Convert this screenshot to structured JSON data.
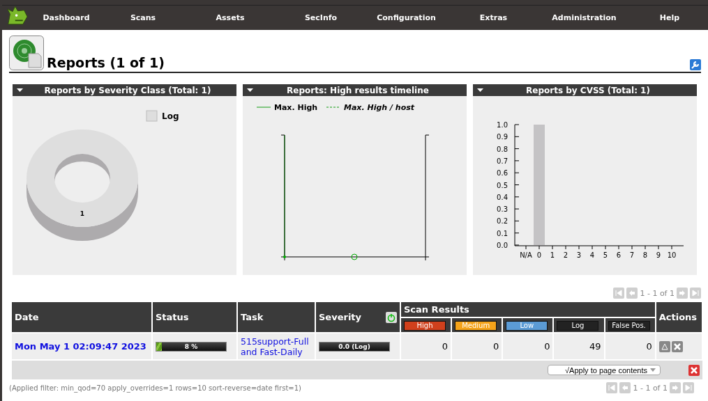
{
  "nav": {
    "items": [
      "Dashboard",
      "Scans",
      "Assets",
      "SecInfo",
      "Configuration",
      "Extras",
      "Administration",
      "Help"
    ]
  },
  "page": {
    "title": "Reports (1 of 1)"
  },
  "charts": [
    {
      "title": "Reports by Severity Class (Total: 1)",
      "chart_data": {
        "type": "pie",
        "series": [
          {
            "name": "Log",
            "color": "#dedede",
            "values": [
              1
            ]
          }
        ],
        "data_labels": true
      }
    },
    {
      "kind": "timeline",
      "title": "Reports: High results timeline",
      "legend": [
        {
          "label": "Max. High",
          "kind": "solid"
        },
        {
          "label": "Max. High / host",
          "kind": "dashed"
        }
      ]
    },
    {
      "title": "Reports by CVSS (Total: 1)",
      "chart_data": {
        "type": "bar",
        "categories": [
          "N/A",
          "0",
          "1",
          "2",
          "3",
          "4",
          "5",
          "6",
          "7",
          "8",
          "9",
          "10"
        ],
        "values": [
          0,
          1,
          0,
          0,
          0,
          0,
          0,
          0,
          0,
          0,
          0,
          0
        ],
        "ylim": [
          0,
          1
        ],
        "yticks": [
          {
            "value": 0,
            "label": "0.0"
          },
          0.1,
          0.2,
          0.3,
          0.4,
          0.5,
          0.6,
          0.7,
          0.8,
          0.9,
          {
            "value": 1,
            "label": "1.0"
          }
        ]
      }
    }
  ],
  "pager_top": {
    "text": "1 - 1 of 1"
  },
  "table": {
    "columns": [
      "Date",
      "Status",
      "Task",
      "Severity"
    ],
    "group": "Scan Results",
    "actions": "Actions",
    "result_columns": [
      {
        "label": "High",
        "color": "#d0401c"
      },
      {
        "label": "Medium",
        "color": "#f5a31a"
      },
      {
        "label": "Low",
        "color": "#5b9bd5"
      },
      {
        "label": "Log",
        "color": "#222222"
      },
      {
        "label": "False Pos.",
        "color": "#222222"
      }
    ],
    "rows": [
      {
        "date": "Mon May 1 02:09:47 2023",
        "status": {
          "text": "8 %",
          "level": 0.08
        },
        "task": "515support-Full and Fast-Daily",
        "severity": {
          "text": "0.0 (Log)",
          "level": 0
        },
        "results": [
          "0",
          "0",
          "0",
          "49",
          "0"
        ]
      }
    ]
  },
  "filter_bar": {
    "apply": "√Apply to page contents"
  },
  "applied_filter": "(Applied filter: min_qod=70 apply_overrides=1 rows=10 sort-reverse=date first=1)",
  "pager_bottom": {
    "text": "1 - 1 of 1"
  }
}
